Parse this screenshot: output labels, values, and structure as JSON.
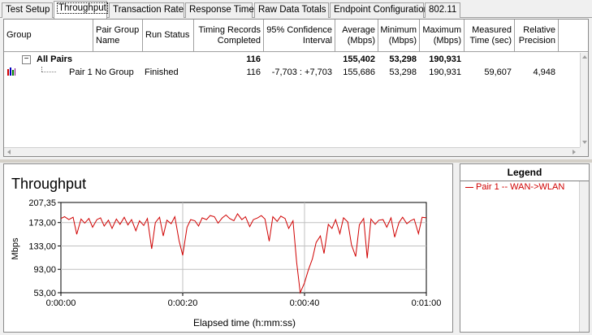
{
  "tabs": [
    {
      "label": "Test Setup"
    },
    {
      "label": "Throughput"
    },
    {
      "label": "Transaction Rate"
    },
    {
      "label": "Response Time"
    },
    {
      "label": "Raw Data Totals"
    },
    {
      "label": "Endpoint Configuration"
    },
    {
      "label": "802.11"
    }
  ],
  "grid": {
    "headers": {
      "group": "Group",
      "pair_group_name": "Pair Group Name",
      "run_status": "Run Status",
      "timing_records": "Timing Records Completed",
      "confidence": "95% Confidence Interval",
      "average": "Average (Mbps)",
      "minimum": "Minimum (Mbps)",
      "maximum": "Maximum (Mbps)",
      "measured_time": "Measured Time (sec)",
      "relative_precision": "Relative Precision"
    },
    "all_pairs": {
      "expander": "−",
      "label": "All Pairs",
      "timing_records": "116",
      "average": "155,402",
      "minimum": "53,298",
      "maximum": "190,931"
    },
    "pair1": {
      "label": "Pair 1",
      "group_name": "No Group",
      "status": "Finished",
      "timing_records": "116",
      "confidence": "-7,703 : +7,703",
      "average": "155,686",
      "minimum": "53,298",
      "maximum": "190,931",
      "measured_time": "59,607",
      "relative_precision": "4,948"
    }
  },
  "legend": {
    "title": "Legend",
    "items": [
      {
        "label": "Pair 1 -- WAN->WLAN",
        "color": "#d00000"
      }
    ]
  },
  "chart_data": {
    "type": "line",
    "title": "Throughput",
    "xlabel": "Elapsed time (h:mm:ss)",
    "ylabel": "Mbps",
    "x_ticks": [
      "0:00:00",
      "0:00:20",
      "0:00:40",
      "0:01:00"
    ],
    "y_ticks": [
      "53,00",
      "93,00",
      "133,00",
      "173,00",
      "207,35"
    ],
    "xlim": [
      0,
      60
    ],
    "ylim": [
      53,
      207.35
    ],
    "grid": true,
    "series": [
      {
        "name": "Pair 1 -- WAN->WLAN",
        "color": "#d00000",
        "x": [
          0,
          0.6,
          1.3,
          2.0,
          2.6,
          3.3,
          3.9,
          4.6,
          5.2,
          5.9,
          6.5,
          7.1,
          7.8,
          8.4,
          9.1,
          9.7,
          10.4,
          11.0,
          11.6,
          12.3,
          12.9,
          13.6,
          14.2,
          14.9,
          15.5,
          16.2,
          16.8,
          17.4,
          18.1,
          18.7,
          19.4,
          20.0,
          20.7,
          21.3,
          22.0,
          22.6,
          23.2,
          23.9,
          24.5,
          25.2,
          25.8,
          26.5,
          27.1,
          27.7,
          28.4,
          29.0,
          29.7,
          30.3,
          31.0,
          31.6,
          32.3,
          32.9,
          33.5,
          34.2,
          34.8,
          35.5,
          36.1,
          36.8,
          37.4,
          38.1,
          38.7,
          39.3,
          40.0,
          40.6,
          41.3,
          41.9,
          42.6,
          43.2,
          43.9,
          44.5,
          45.1,
          45.8,
          46.4,
          47.1,
          47.7,
          48.4,
          49.0,
          49.7,
          50.3,
          50.9,
          51.6,
          52.2,
          52.9,
          53.5,
          54.2,
          54.8,
          55.5,
          56.1,
          56.8,
          57.4,
          58.0,
          58.7,
          59.3,
          60.0
        ],
        "values": [
          180,
          183,
          178,
          182,
          153,
          179,
          172,
          180,
          165,
          178,
          181,
          167,
          177,
          163,
          179,
          170,
          182,
          169,
          178,
          159,
          176,
          168,
          180,
          128,
          173,
          182,
          150,
          177,
          171,
          183,
          142,
          117,
          165,
          178,
          176,
          167,
          181,
          178,
          185,
          183,
          172,
          181,
          186,
          180,
          176,
          188,
          178,
          183,
          166,
          178,
          181,
          185,
          179,
          141,
          183,
          175,
          184,
          180,
          163,
          176,
          105,
          53,
          70,
          91,
          111,
          139,
          150,
          120,
          170,
          163,
          178,
          154,
          181,
          174,
          135,
          115,
          169,
          180,
          112,
          179,
          170,
          177,
          178,
          165,
          181,
          148,
          173,
          182,
          171,
          176,
          179,
          154,
          182,
          181
        ]
      }
    ]
  }
}
